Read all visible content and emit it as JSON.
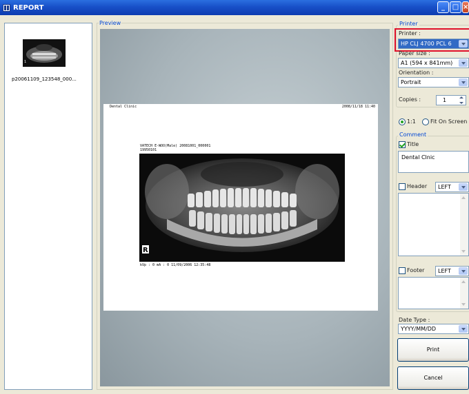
{
  "window": {
    "title": "REPORT"
  },
  "thumbnails": [
    {
      "label": "p20061109_123548_000..."
    }
  ],
  "preview": {
    "legend": "Preview",
    "paper": {
      "header_left": "Dental Clinic",
      "header_right": "2008/11/18  11:40",
      "image_title": "VATECH E-WOO(Male) 20081001_000001",
      "image_subtitle": "19950101",
      "image_footer": "kVp : 0    mA : 0    11/09/2006 12:35:48",
      "image_marker": "R"
    }
  },
  "printer": {
    "legend": "Printer",
    "printer_label": "Printer :",
    "printer_value": "HP CLJ 4700 PCL 6",
    "paper_size_label": "Paper size :",
    "paper_size_value": "A1 (594 x 841mm)",
    "orientation_label": "Orientation :",
    "orientation_value": "Portrait",
    "copies_label": "Copies :",
    "copies_value": "1",
    "scale_options": [
      {
        "label": "1:1",
        "selected": true
      },
      {
        "label": "Fit On Screen",
        "selected": false
      }
    ]
  },
  "comment": {
    "legend": "Comment",
    "title_label": "Title",
    "title_checked": true,
    "title_text": "Dental Clnic",
    "header_label": "Header",
    "header_checked": false,
    "header_align": "LEFT",
    "footer_label": "Footer",
    "footer_checked": false,
    "footer_align": "LEFT"
  },
  "date_type": {
    "label": "Date Type :",
    "value": "YYYY/MM/DD"
  },
  "buttons": {
    "print": "Print",
    "cancel": "Cancel"
  },
  "colors": {
    "titlebar": "#1850c8",
    "legend_text": "#0046d5",
    "highlight_box": "#e0102a",
    "selection": "#316ac5"
  }
}
